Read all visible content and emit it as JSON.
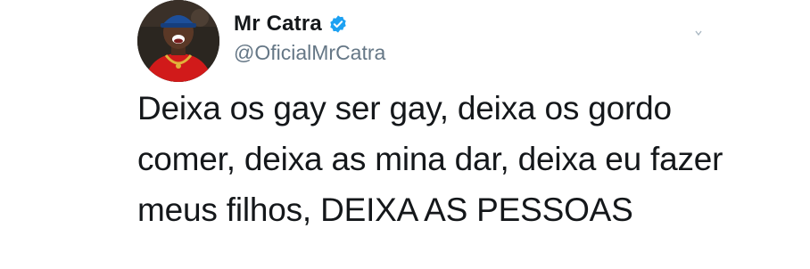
{
  "author": {
    "display_name": "Mr Catra",
    "handle": "@OficialMrCatra",
    "verified": true,
    "avatar_icon": "profile-photo"
  },
  "tweet": {
    "text": "Deixa os gay ser gay, deixa os gordo\ncomer, deixa as mina dar, deixa eu fazer\nmeus filhos, DEIXA AS PESSOAS"
  },
  "colors": {
    "verified_badge": "#1da1f2",
    "name": "#14171a",
    "handle": "#657786"
  }
}
